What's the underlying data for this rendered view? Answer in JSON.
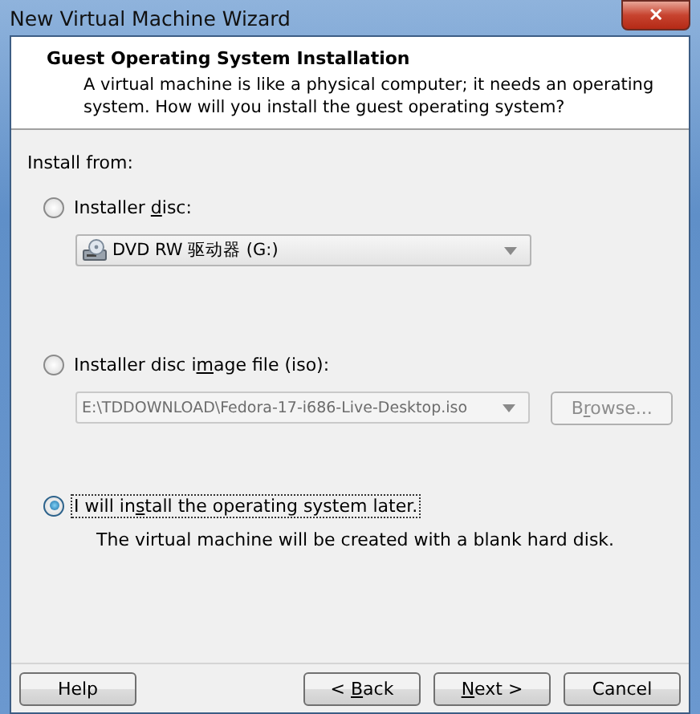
{
  "window": {
    "title": "New Virtual Machine Wizard",
    "close": "✕"
  },
  "header": {
    "title": "Guest Operating System Installation",
    "description": "A virtual machine is like a physical computer; it needs an operating system. How will you install the guest operating system?"
  },
  "install_from": "Install from:",
  "options": [
    {
      "kind": "disc",
      "label_parts": [
        "Installer ",
        "d",
        "isc:"
      ],
      "selected": false,
      "focused": false,
      "dropdown": {
        "value": "DVD RW 驱动器 (G:)",
        "disabled": false
      }
    },
    {
      "kind": "iso",
      "label_parts": [
        "Installer disc i",
        "m",
        "age file (iso):"
      ],
      "selected": false,
      "focused": false,
      "dropdown": {
        "value": "E:\\TDDOWNLOAD\\Fedora-17-i686-Live-Desktop.iso",
        "disabled": true
      },
      "browse": {
        "label_parts": [
          "B",
          "r",
          "owse..."
        ],
        "disabled": true
      }
    },
    {
      "kind": "later",
      "label_parts": [
        "I will in",
        "s",
        "tall the operating system later."
      ],
      "selected": true,
      "focused": true,
      "note": "The virtual machine will be created with a blank hard disk."
    }
  ],
  "buttons": [
    {
      "kind": "help",
      "label": {
        "before": "Help"
      }
    },
    {
      "kind": "back",
      "label": {
        "before": "< ",
        "key": "B",
        "after": "ack"
      }
    },
    {
      "kind": "next",
      "label": {
        "key": "N",
        "after": "ext >"
      }
    },
    {
      "kind": "cancel",
      "label": {
        "before": "Cancel"
      }
    }
  ]
}
